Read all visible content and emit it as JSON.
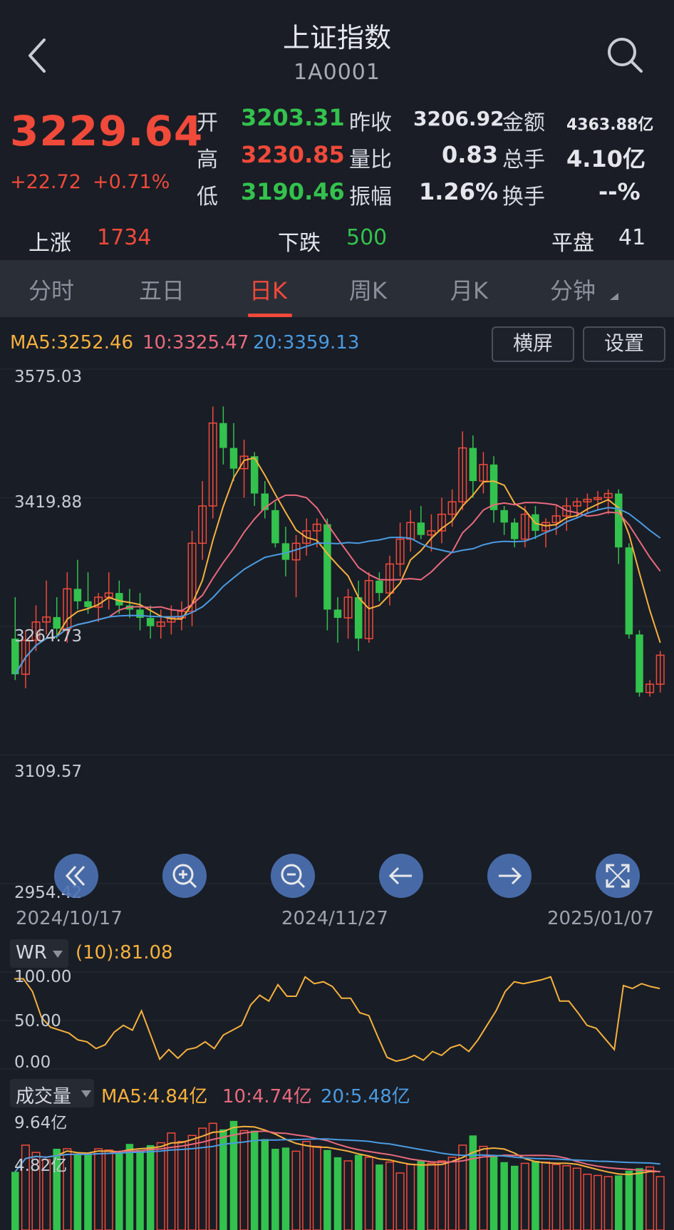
{
  "header": {
    "title": "上证指数",
    "code": "1A0001"
  },
  "quote": {
    "price": "3229.64",
    "change": "+22.72",
    "change_pct": "+0.71%",
    "rows": [
      {
        "l1": "开",
        "v1": "3203.31",
        "l2": "昨收",
        "v2": "3206.92",
        "l3": "金额",
        "v3": "4363.88亿"
      },
      {
        "l1": "高",
        "v1": "3230.85",
        "l2": "量比",
        "v2": "0.83",
        "l3": "总手",
        "v3": "4.10亿"
      },
      {
        "l1": "低",
        "v1": "3190.46",
        "l2": "振幅",
        "v2": "1.26%",
        "l3": "换手",
        "v3": "--%"
      }
    ]
  },
  "breadth": {
    "up_label": "上涨",
    "up": "1734",
    "down_label": "下跌",
    "down": "500",
    "flat_label": "平盘",
    "flat": "41"
  },
  "tabs": [
    "分时",
    "五日",
    "日K",
    "周K",
    "月K",
    "分钟"
  ],
  "ma_legend": {
    "ma5": "MA5:3252.46",
    "ma10": "10:3325.47",
    "ma20": "20:3359.13"
  },
  "buttons": {
    "landscape": "横屏",
    "settings": "设置"
  },
  "price_axis": [
    "3575.03",
    "3419.88",
    "3264.73",
    "3109.57",
    "2954.42"
  ],
  "dates": [
    "2024/10/17",
    "2024/11/27",
    "2025/01/07"
  ],
  "wr": {
    "name": "WR",
    "value": "(10):81.08",
    "axis": [
      "100.00",
      "50.00",
      "0.00"
    ]
  },
  "volume": {
    "name": "成交量",
    "ma5": "MA5:4.84亿",
    "ma10": "10:4.74亿",
    "ma20": "20:5.48亿",
    "axis": [
      "9.64亿",
      "4.82亿"
    ]
  },
  "colors": {
    "up": "#f04a3a",
    "down": "#33c24d",
    "ma5": "#f5b13d",
    "ma10": "#e86a7c",
    "ma20": "#4a9be0",
    "wr": "#f5b13d"
  },
  "chart_data": [
    {
      "type": "candlestick",
      "title": "",
      "ylim": [
        2954.42,
        3575.03
      ],
      "series": [
        {
          "name": "K",
          "ohlc": [
            [
              3250,
              3300,
              3200,
              3207
            ],
            [
              3207,
              3260,
              3190,
              3248
            ],
            [
              3248,
              3290,
              3235,
              3270
            ],
            [
              3270,
              3320,
              3255,
              3276
            ],
            [
              3276,
              3300,
              3250,
              3262
            ],
            [
              3262,
              3330,
              3245,
              3310
            ],
            [
              3310,
              3345,
              3285,
              3295
            ],
            [
              3295,
              3330,
              3280,
              3288
            ],
            [
              3288,
              3305,
              3270,
              3300
            ],
            [
              3300,
              3330,
              3285,
              3305
            ],
            [
              3305,
              3320,
              3280,
              3290
            ],
            [
              3290,
              3310,
              3275,
              3285
            ],
            [
              3285,
              3305,
              3260,
              3275
            ],
            [
              3275,
              3290,
              3250,
              3265
            ],
            [
              3265,
              3285,
              3250,
              3270
            ],
            [
              3270,
              3290,
              3255,
              3275
            ],
            [
              3275,
              3295,
              3260,
              3283
            ],
            [
              3283,
              3380,
              3265,
              3365
            ],
            [
              3365,
              3440,
              3345,
              3410
            ],
            [
              3410,
              3530,
              3395,
              3510
            ],
            [
              3510,
              3530,
              3460,
              3480
            ],
            [
              3480,
              3510,
              3440,
              3455
            ],
            [
              3455,
              3490,
              3420,
              3470
            ],
            [
              3470,
              3475,
              3410,
              3425
            ],
            [
              3425,
              3440,
              3395,
              3405
            ],
            [
              3405,
              3415,
              3360,
              3365
            ],
            [
              3365,
              3385,
              3325,
              3345
            ],
            [
              3345,
              3375,
              3300,
              3365
            ],
            [
              3365,
              3395,
              3350,
              3380
            ],
            [
              3380,
              3395,
              3360,
              3388
            ],
            [
              3388,
              3395,
              3260,
              3285
            ],
            [
              3285,
              3300,
              3245,
              3275
            ],
            [
              3275,
              3310,
              3250,
              3300
            ],
            [
              3300,
              3320,
              3235,
              3250
            ],
            [
              3250,
              3330,
              3245,
              3320
            ],
            [
              3320,
              3330,
              3295,
              3305
            ],
            [
              3305,
              3350,
              3290,
              3340
            ],
            [
              3340,
              3390,
              3325,
              3370
            ],
            [
              3370,
              3405,
              3355,
              3390
            ],
            [
              3390,
              3410,
              3370,
              3375
            ],
            [
              3375,
              3400,
              3355,
              3380
            ],
            [
              3380,
              3420,
              3365,
              3400
            ],
            [
              3400,
              3430,
              3385,
              3415
            ],
            [
              3415,
              3500,
              3405,
              3480
            ],
            [
              3480,
              3495,
              3420,
              3440
            ],
            [
              3440,
              3475,
              3425,
              3460
            ],
            [
              3460,
              3470,
              3390,
              3405
            ],
            [
              3405,
              3410,
              3375,
              3390
            ],
            [
              3390,
              3395,
              3360,
              3370
            ],
            [
              3370,
              3410,
              3360,
              3400
            ],
            [
              3400,
              3410,
              3370,
              3380
            ],
            [
              3380,
              3395,
              3360,
              3390
            ],
            [
              3390,
              3410,
              3375,
              3398
            ],
            [
              3398,
              3420,
              3380,
              3410
            ],
            [
              3410,
              3420,
              3395,
              3415
            ],
            [
              3415,
              3425,
              3400,
              3418
            ],
            [
              3418,
              3428,
              3405,
              3420
            ],
            [
              3420,
              3430,
              3400,
              3425
            ],
            [
              3425,
              3430,
              3340,
              3360
            ],
            [
              3360,
              3365,
              3250,
              3255
            ],
            [
              3255,
              3260,
              3180,
              3185
            ],
            [
              3185,
              3200,
              3180,
              3195
            ],
            [
              3195,
              3235,
              3185,
              3230
            ]
          ]
        }
      ]
    },
    {
      "type": "line",
      "title": "",
      "ylim": [
        0,
        100
      ],
      "series": [
        {
          "name": "WR",
          "values": [
            93,
            93,
            80,
            53,
            43,
            40,
            37,
            30,
            28,
            21,
            25,
            38,
            45,
            40,
            60,
            35,
            10,
            20,
            11,
            20,
            22,
            28,
            21,
            35,
            40,
            45,
            66,
            76,
            70,
            87,
            75,
            75,
            95,
            88,
            90,
            85,
            73,
            73,
            58,
            55,
            33,
            12,
            8,
            10,
            14,
            9,
            18,
            14,
            22,
            25,
            18,
            30,
            45,
            60,
            80,
            90,
            88,
            90,
            92,
            95,
            70,
            70,
            58,
            45,
            42,
            31,
            20,
            86,
            83,
            88,
            85,
            83
          ]
        }
      ]
    },
    {
      "type": "bar",
      "title": "",
      "ylim": [
        0,
        9.64
      ],
      "series": [
        {
          "name": "成交量",
          "values": [
            4.8,
            7,
            6.4,
            5.8,
            6.7,
            6.7,
            6.3,
            6.2,
            6.7,
            6.6,
            6.5,
            7.1,
            6.6,
            7.0,
            7.2,
            8.0,
            7.3,
            7.8,
            8.4,
            8.8,
            8.3,
            9.0,
            8.2,
            8.2,
            7.5,
            6.7,
            6.8,
            6.5,
            7.3,
            6.9,
            6.6,
            6.0,
            5.7,
            6.2,
            6.0,
            5.4,
            5.6,
            4.7,
            5.4,
            5.7,
            5.5,
            5.7,
            6.0,
            7.0,
            7.8,
            6.9,
            6.1,
            5.6,
            5.3,
            5.5,
            5.7,
            5.6,
            5.4,
            5.3,
            5.1,
            4.6,
            4.5,
            4.4,
            4.5,
            4.9,
            5.1,
            5.2,
            4.4
          ]
        }
      ]
    }
  ]
}
